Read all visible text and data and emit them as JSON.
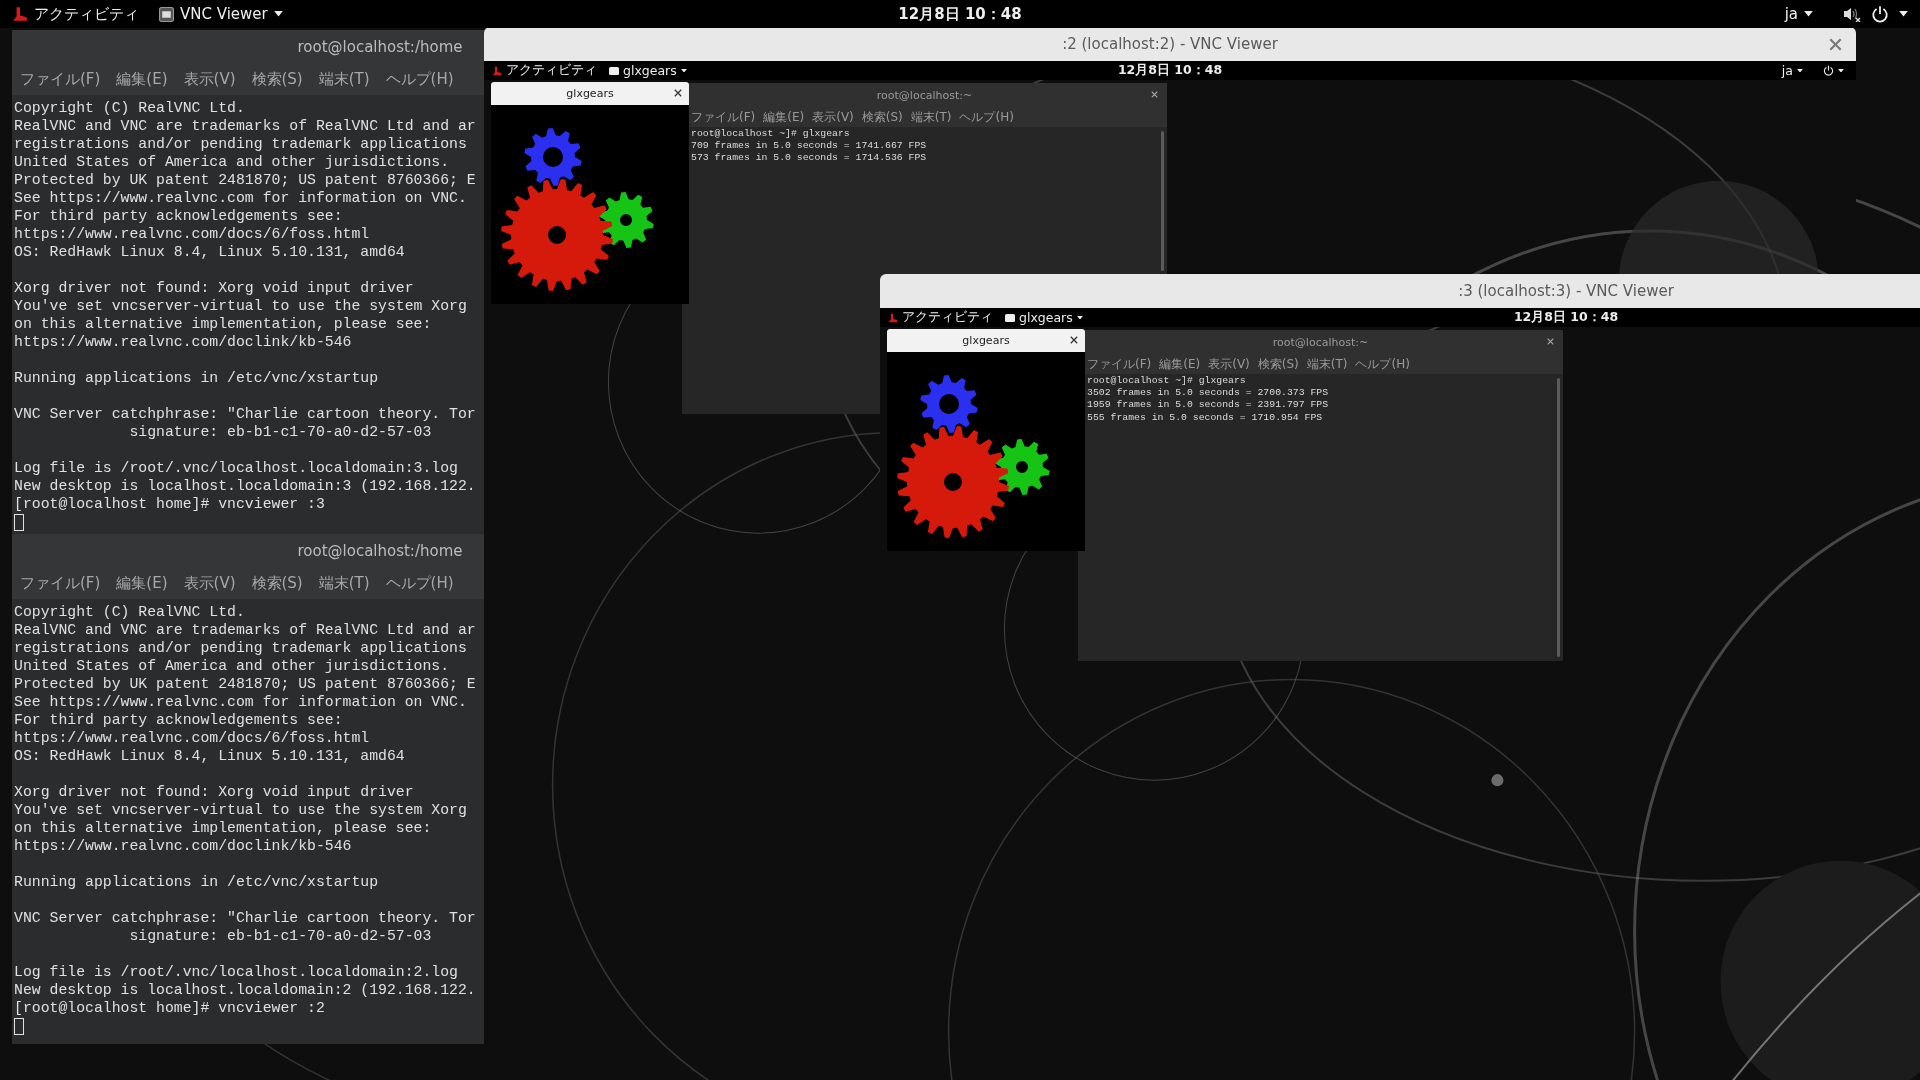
{
  "top_bar": {
    "activities": "アクティビティ",
    "app_menu": "VNC Viewer",
    "clock": "12月8日 10：48",
    "language": "ja",
    "volume_muted": true
  },
  "terminals": [
    {
      "title": "root@localhost:/home",
      "menu": [
        "ファイル(F)",
        "編集(E)",
        "表示(V)",
        "検索(S)",
        "端末(T)",
        "ヘルプ(H)"
      ],
      "paragraphs": [
        [
          "Copyright (C) RealVNC Ltd.",
          "RealVNC and VNC are trademarks of RealVNC Ltd and ar",
          "registrations and/or pending trademark applications",
          "United States of America and other jurisdictions.",
          "Protected by UK patent 2481870; US patent 8760366; E",
          "See https://www.realvnc.com for information on VNC.",
          "For third party acknowledgements see:",
          "https://www.realvnc.com/docs/6/foss.html",
          "OS: RedHawk Linux 8.4, Linux 5.10.131, amd64"
        ],
        [
          "Xorg driver not found: Xorg void input driver",
          "You've set vncserver-virtual to use the system Xorg",
          "on this alternative implementation, please see:",
          "https://www.realvnc.com/doclink/kb-546"
        ],
        [
          "Running applications in /etc/vnc/xstartup"
        ],
        [
          "VNC Server catchphrase: \"Charlie cartoon theory. Tor",
          "             signature: eb-b1-c1-70-a0-d2-57-03"
        ],
        [
          "Log file is /root/.vnc/localhost.localdomain:3.log",
          "New desktop is localhost.localdomain:3 (192.168.122.",
          "[root@localhost home]# vncviewer :3"
        ]
      ],
      "cursor": true
    },
    {
      "title": "root@localhost:/home",
      "menu": [
        "ファイル(F)",
        "編集(E)",
        "表示(V)",
        "検索(S)",
        "端末(T)",
        "ヘルプ(H)"
      ],
      "paragraphs": [
        [
          "Copyright (C) RealVNC Ltd.",
          "RealVNC and VNC are trademarks of RealVNC Ltd and ar",
          "registrations and/or pending trademark applications",
          "United States of America and other jurisdictions.",
          "Protected by UK patent 2481870; US patent 8760366; E",
          "See https://www.realvnc.com for information on VNC.",
          "For third party acknowledgements see:",
          "https://www.realvnc.com/docs/6/foss.html",
          "OS: RedHawk Linux 8.4, Linux 5.10.131, amd64"
        ],
        [
          "Xorg driver not found: Xorg void input driver",
          "You've set vncserver-virtual to use the system Xorg",
          "on this alternative implementation, please see:",
          "https://www.realvnc.com/doclink/kb-546"
        ],
        [
          "Running applications in /etc/vnc/xstartup"
        ],
        [
          "VNC Server catchphrase: \"Charlie cartoon theory. Tor",
          "             signature: eb-b1-c1-70-a0-d2-57-03"
        ],
        [
          "Log file is /root/.vnc/localhost.localdomain:2.log",
          "New desktop is localhost.localdomain:2 (192.168.122.",
          "[root@localhost home]# vncviewer :2"
        ]
      ],
      "cursor": true
    }
  ],
  "vnc_windows": [
    {
      "title": ":2 (localhost:2) - VNC Viewer",
      "close_button": true,
      "top_bar": {
        "activities": "アクティビティ",
        "app_menu": "glxgears",
        "clock": "12月8日 10：48",
        "language": "ja",
        "power_menu": true
      },
      "gears_window": {
        "title": "glxgears",
        "close_button": true
      },
      "terminal": {
        "title": "root@localhost:~",
        "close_button": true,
        "menu": [
          "ファイル(F)",
          "編集(E)",
          "表示(V)",
          "検索(S)",
          "端末(T)",
          "ヘルプ(H)"
        ],
        "lines": [
          "root@localhost ~]# glxgears",
          "709 frames in 5.0 seconds = 1741.667 FPS",
          "573 frames in 5.0 seconds = 1714.536 FPS"
        ]
      }
    },
    {
      "title": ":3 (localhost:3) - VNC Viewer",
      "close_button": false,
      "top_bar": {
        "activities": "アクティビティ",
        "app_menu": "glxgears",
        "clock": "12月8日 10：48",
        "power_menu": false
      },
      "gears_window": {
        "title": "glxgears",
        "close_button": true
      },
      "terminal": {
        "title": "root@localhost:~",
        "close_button": true,
        "menu": [
          "ファイル(F)",
          "編集(E)",
          "表示(V)",
          "検索(S)",
          "端末(T)",
          "ヘルプ(H)"
        ],
        "lines": [
          "root@localhost ~]# glxgears",
          "3502 frames in 5.0 seconds = 2700.373 FPS",
          "1959 frames in 5.0 seconds = 2391.797 FPS",
          "555 frames in 5.0 seconds = 1710.954 FPS"
        ]
      }
    }
  ]
}
